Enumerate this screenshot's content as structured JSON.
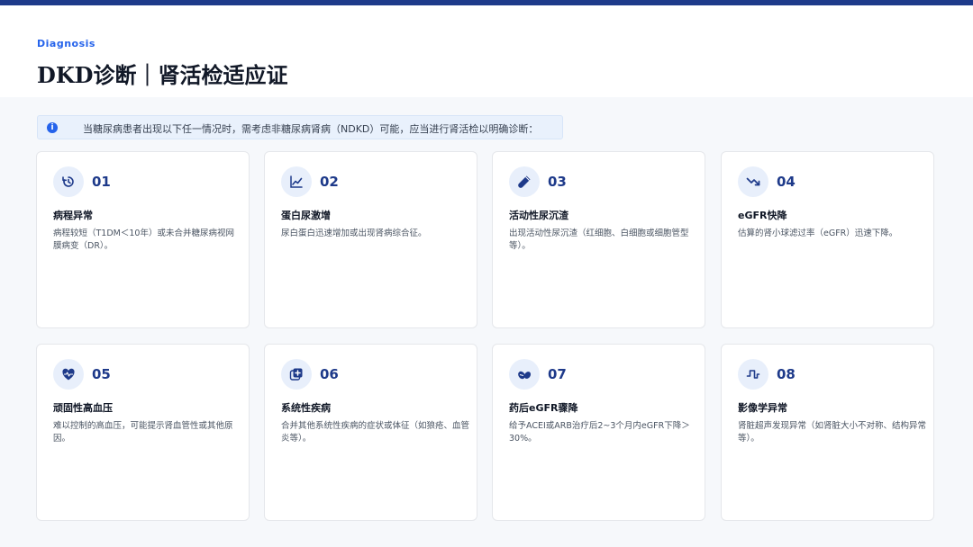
{
  "header": {
    "kicker": "Diagnosis",
    "title": "DKD诊断｜肾活检适应证"
  },
  "notice": {
    "icon": "info-icon",
    "text": "当糖尿病患者出现以下任一情况时，需考虑非糖尿病肾病（NDKD）可能，应当进行肾活检以明确诊断："
  },
  "colors": {
    "accent": "#2563eb",
    "brand": "#1e3a8a",
    "icon_bg": "#e8effb"
  },
  "cards": [
    {
      "num": "01",
      "icon": "history-icon",
      "title": "病程异常",
      "desc": "病程较短（T1DM＜10年）或未合并糖尿病视网膜病变（DR）。"
    },
    {
      "num": "02",
      "icon": "trend-up-icon",
      "title": "蛋白尿激增",
      "desc": "尿白蛋白迅速增加或出现肾病综合征。"
    },
    {
      "num": "03",
      "icon": "vial-icon",
      "title": "活动性尿沉渣",
      "desc": "出现活动性尿沉渣（红细胞、白细胞或细胞管型等）。"
    },
    {
      "num": "04",
      "icon": "trend-down-icon",
      "title": "eGFR快降",
      "desc": "估算的肾小球滤过率（eGFR）迅速下降。"
    },
    {
      "num": "05",
      "icon": "heart-pulse-icon",
      "title": "顽固性高血压",
      "desc": "难以控制的高血压，可能提示肾血管性或其他原因。"
    },
    {
      "num": "06",
      "icon": "medical-add-icon",
      "title": "系统性疾病",
      "desc": "合并其他系统性疾病的症状或体征（如狼疮、血管炎等）。"
    },
    {
      "num": "07",
      "icon": "pills-icon",
      "title": "药后eGFR骤降",
      "desc": "给予ACEI或ARB治疗后2~3个月内eGFR下降＞30%。"
    },
    {
      "num": "08",
      "icon": "waveform-icon",
      "title": "影像学异常",
      "desc": "肾脏超声发现异常（如肾脏大小不对称、结构异常等）。"
    }
  ]
}
